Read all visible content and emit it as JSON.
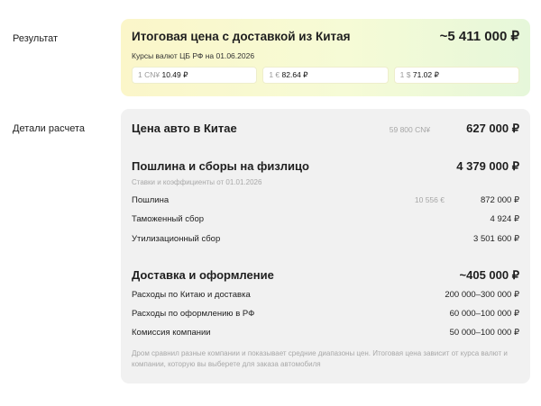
{
  "labels": {
    "result": "Результат",
    "details": "Детали расчета"
  },
  "result": {
    "title": "Итоговая цена с доставкой из Китая",
    "total": "~5 411 000 ₽",
    "rates_caption": "Курсы валют ЦБ РФ на 01.06.2026",
    "rates": [
      {
        "currency": "1 CN¥",
        "value": "10.49 ₽"
      },
      {
        "currency": "1 €",
        "value": "82.64 ₽"
      },
      {
        "currency": "1 $",
        "value": "71.02 ₽"
      }
    ]
  },
  "details": {
    "car_price": {
      "label": "Цена авто в Китае",
      "original": "59 800 CN¥",
      "amount": "627 000 ₽"
    },
    "duties": {
      "title": "Пошлина и сборы на физлицо",
      "amount": "4 379 000 ₽",
      "subtitle": "Ставки и коэффициенты от 01.01.2026",
      "items": [
        {
          "label": "Пошлина",
          "original": "10 556 €",
          "amount": "872 000 ₽"
        },
        {
          "label": "Таможенный сбор",
          "original": "",
          "amount": "4 924 ₽"
        },
        {
          "label": "Утилизационный сбор",
          "original": "",
          "amount": "3 501 600 ₽"
        }
      ]
    },
    "delivery": {
      "title": "Доставка и оформление",
      "amount": "~405 000 ₽",
      "items": [
        {
          "label": "Расходы по Китаю и доставка",
          "amount": "200 000–300 000 ₽"
        },
        {
          "label": "Расходы по оформлению в РФ",
          "amount": "60 000–100 000 ₽"
        },
        {
          "label": "Комиссия компании",
          "amount": "50 000–100 000 ₽"
        }
      ]
    },
    "note": "Дром сравнил разные компании и показывает средние диапазоны цен. Итоговая цена зависит от курса валют и компании, которую вы выберете для заказа автомобиля"
  }
}
